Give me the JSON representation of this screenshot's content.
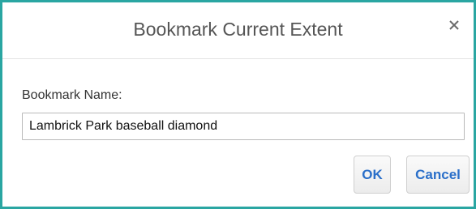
{
  "dialog": {
    "title": "Bookmark Current Extent",
    "close_icon": "close-icon",
    "name_label": "Bookmark Name:",
    "name_value": "Lambrick Park baseball diamond",
    "ok_label": "OK",
    "cancel_label": "Cancel"
  },
  "colors": {
    "border_accent": "#2aa6a2",
    "button_text": "#2a6fc9"
  }
}
